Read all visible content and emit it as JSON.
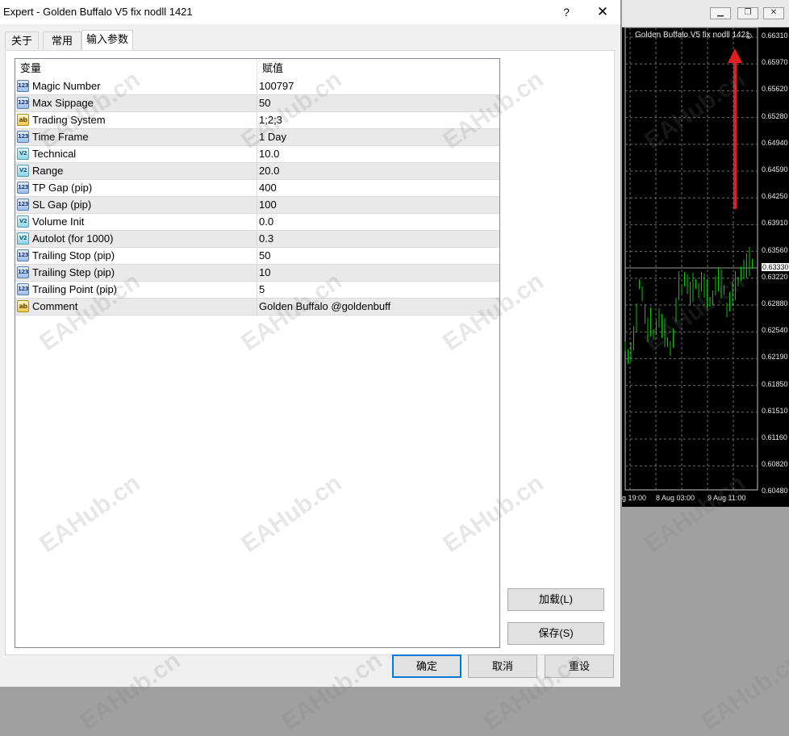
{
  "window": {
    "title": "Expert - Golden Buffalo V5 fix nodll 1421",
    "help_label": "?",
    "close_label": "✕"
  },
  "tabs": [
    {
      "label": "关于"
    },
    {
      "label": "常用"
    },
    {
      "label": "输入参数"
    }
  ],
  "grid": {
    "header_variable": "变量",
    "header_value": "赋值",
    "rows": [
      {
        "type": "int",
        "icon": "123",
        "name": "Magic Number",
        "value": "100797"
      },
      {
        "type": "int",
        "icon": "123",
        "name": "Max Sippage",
        "value": "50"
      },
      {
        "type": "str",
        "icon": "ab",
        "name": "Trading System",
        "value": "1;2;3"
      },
      {
        "type": "int",
        "icon": "123",
        "name": "Time Frame",
        "value": "1 Day"
      },
      {
        "type": "dbl",
        "icon": "V2",
        "name": "Technical",
        "value": "10.0"
      },
      {
        "type": "dbl",
        "icon": "V2",
        "name": "Range",
        "value": "20.0"
      },
      {
        "type": "int",
        "icon": "123",
        "name": "TP Gap (pip)",
        "value": "400"
      },
      {
        "type": "int",
        "icon": "123",
        "name": "SL Gap (pip)",
        "value": "100"
      },
      {
        "type": "dbl",
        "icon": "V2",
        "name": "Volume Init",
        "value": "0.0"
      },
      {
        "type": "dbl",
        "icon": "V2",
        "name": "Autolot (for 1000)",
        "value": "0.3"
      },
      {
        "type": "int",
        "icon": "123",
        "name": "Trailing Stop (pip)",
        "value": "50"
      },
      {
        "type": "int",
        "icon": "123",
        "name": "Trailing Step (pip)",
        "value": "10"
      },
      {
        "type": "int",
        "icon": "123",
        "name": "Trailing Point (pip)",
        "value": "5"
      },
      {
        "type": "str",
        "icon": "ab",
        "name": "Comment",
        "value": "Golden Buffalo @goldenbuff"
      }
    ]
  },
  "buttons": {
    "load": "加载(L)",
    "save": "保存(S)",
    "ok": "确定",
    "cancel": "取消",
    "reset": "重设"
  },
  "chart": {
    "title": "Golden Buffalo V5 fix nodll 1421",
    "smile_icon": "☺",
    "current_price": "0.63330",
    "prices": [
      "0.66310",
      "0.65970",
      "0.65620",
      "0.65280",
      "0.64940",
      "0.64590",
      "0.64250",
      "0.63910",
      "0.63560",
      "0.63220",
      "0.62880",
      "0.62540",
      "0.62190",
      "0.61850",
      "0.61510",
      "0.61160",
      "0.60820",
      "0.60480"
    ],
    "times": [
      "g 19:00",
      "8 Aug 03:00",
      "9 Aug 11:00"
    ],
    "candle_color": "#00c800",
    "arrow_color": "#e02020"
  },
  "watermark": "EAHub.cn"
}
